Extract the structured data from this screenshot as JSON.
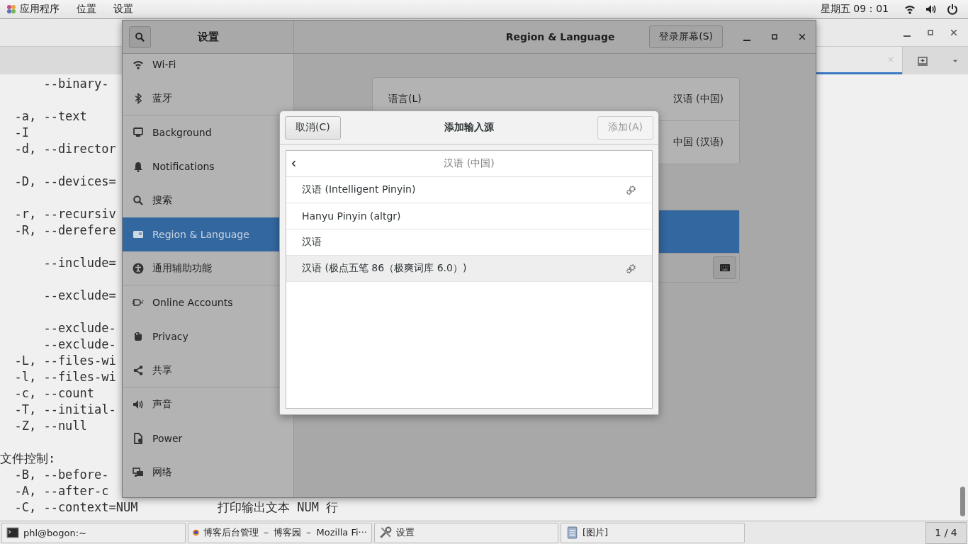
{
  "top_bar": {
    "menus": [
      {
        "label": "应用程序"
      },
      {
        "label": "位置"
      },
      {
        "label": "设置"
      }
    ],
    "clock": "星期五 09：01"
  },
  "terminal": {
    "lines": [
      {
        "kind": "option",
        "long": "--binary-"
      },
      {
        "kind": "blank"
      },
      {
        "kind": "option",
        "flag": "-a,",
        "long": "--text"
      },
      {
        "kind": "option",
        "flag": "-I"
      },
      {
        "kind": "option",
        "flag": "-d,",
        "long": "--director"
      },
      {
        "kind": "blank"
      },
      {
        "kind": "option",
        "flag": "-D,",
        "long": "--devices="
      },
      {
        "kind": "blank"
      },
      {
        "kind": "option",
        "flag": "-r,",
        "long": "--recursiv"
      },
      {
        "kind": "option",
        "flag": "-R,",
        "long": "--derefere"
      },
      {
        "kind": "blank"
      },
      {
        "kind": "option",
        "long": "--include="
      },
      {
        "kind": "blank"
      },
      {
        "kind": "option",
        "long": "--exclude="
      },
      {
        "kind": "blank"
      },
      {
        "kind": "option",
        "long": "--exclude-"
      },
      {
        "kind": "option",
        "long": "--exclude-"
      },
      {
        "kind": "option",
        "flag": "-L,",
        "long": "--files-wi"
      },
      {
        "kind": "option",
        "flag": "-l,",
        "long": "--files-wi"
      },
      {
        "kind": "option",
        "flag": "-c,",
        "long": "--count"
      },
      {
        "kind": "option",
        "flag": "-T,",
        "long": "--initial-"
      },
      {
        "kind": "option",
        "flag": "-Z,",
        "long": "--null"
      },
      {
        "kind": "blank"
      },
      {
        "kind": "heading",
        "text": "文件控制:"
      },
      {
        "kind": "option",
        "flag": "-B,",
        "long": "--before-"
      },
      {
        "kind": "option",
        "flag": "-A,",
        "long": "--after-c"
      },
      {
        "kind": "option",
        "flag": "-C,",
        "long": "--context=NUM",
        "desc": "打印输出文本 NUM 行"
      }
    ]
  },
  "settings": {
    "sidebar_title": "设置",
    "title": "Region & Language",
    "header_button": "登录屏幕(S)",
    "sidebar": {
      "items": [
        {
          "label": "Wi-Fi",
          "selected": false,
          "divider_before": false
        },
        {
          "label": "蓝牙",
          "selected": false,
          "divider_before": false
        },
        {
          "label": "Background",
          "selected": false,
          "divider_before": true
        },
        {
          "label": "Notifications",
          "selected": false,
          "divider_before": false
        },
        {
          "label": "搜索",
          "selected": false,
          "divider_before": false
        },
        {
          "label": "Region & Language",
          "selected": true,
          "divider_before": false
        },
        {
          "label": "通用辅助功能",
          "selected": false,
          "divider_before": false
        },
        {
          "label": "Online Accounts",
          "selected": false,
          "divider_before": true
        },
        {
          "label": "Privacy",
          "selected": false,
          "divider_before": false
        },
        {
          "label": "共享",
          "selected": false,
          "divider_before": false
        },
        {
          "label": "声音",
          "selected": false,
          "divider_before": true
        },
        {
          "label": "Power",
          "selected": false,
          "divider_before": false
        },
        {
          "label": "网络",
          "selected": false,
          "divider_before": false
        }
      ]
    },
    "language": {
      "label": "语言(L)",
      "value": "汉语 (中国)"
    },
    "formats": {
      "value": "中国 (汉语)"
    },
    "input_sources": {
      "rows": [
        {
          "selected": true
        }
      ]
    }
  },
  "dialog": {
    "cancel": "取消(C)",
    "title": "添加输入源",
    "add": {
      "label": "添加(A)",
      "disabled": true
    },
    "list_header": "汉语 (中国)",
    "items": [
      {
        "label": "汉语 (Intelligent Pinyin)",
        "has_settings": true,
        "hovered": false
      },
      {
        "label": "Hanyu Pinyin (altgr)",
        "has_settings": false,
        "hovered": false
      },
      {
        "label": "汉语",
        "has_settings": false,
        "hovered": false
      },
      {
        "label": "汉语 (极点五笔 86（极爽词库 6.0）)",
        "has_settings": true,
        "hovered": true
      }
    ]
  },
  "taskbar": {
    "items": [
      {
        "label": "phl@bogon:~"
      },
      {
        "label": "博客后台管理 － 博客园 － Mozilla Fi···"
      },
      {
        "label": "设置"
      },
      {
        "label": "[图片]"
      }
    ],
    "workspace": "1 / 4"
  }
}
